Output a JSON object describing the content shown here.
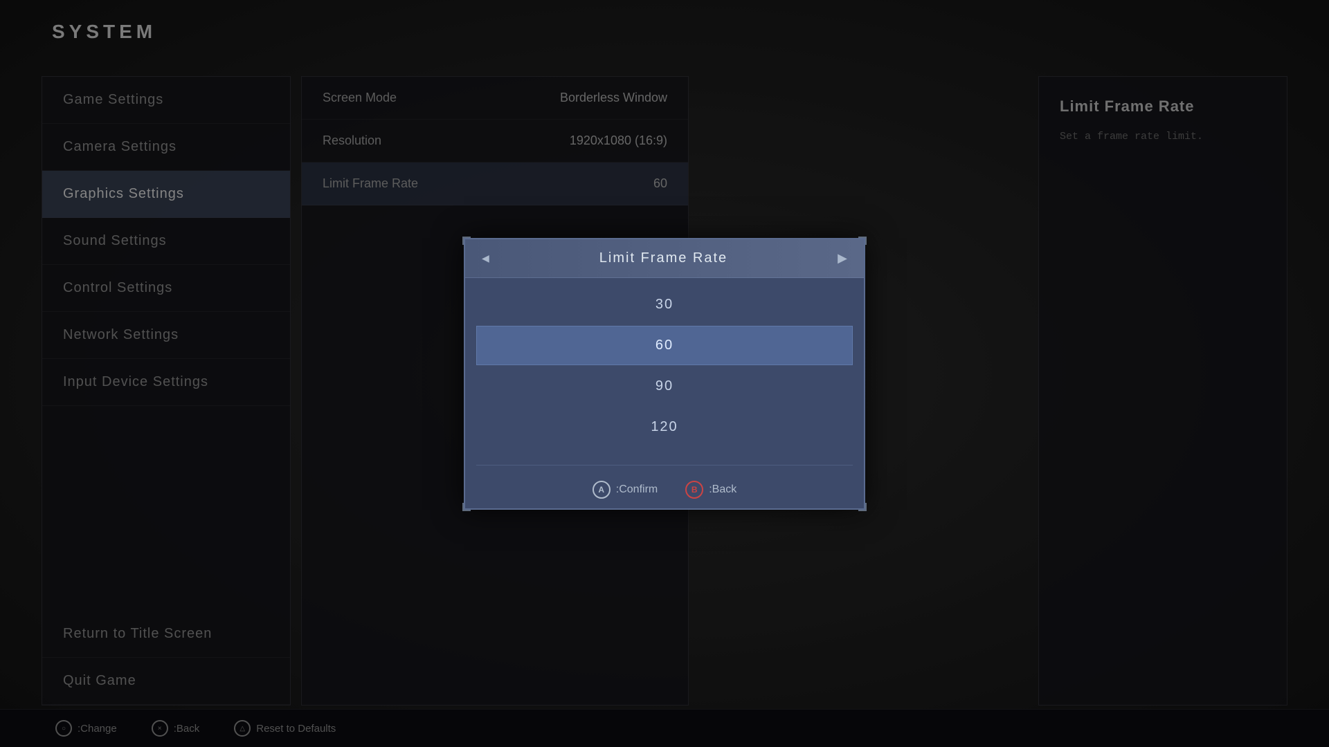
{
  "system": {
    "title": "SYSTEM"
  },
  "sidebar": {
    "items": [
      {
        "id": "game-settings",
        "label": "Game Settings",
        "active": false
      },
      {
        "id": "camera-settings",
        "label": "Camera Settings",
        "active": false
      },
      {
        "id": "graphics-settings",
        "label": "Graphics Settings",
        "active": true
      },
      {
        "id": "sound-settings",
        "label": "Sound Settings",
        "active": false
      },
      {
        "id": "control-settings",
        "label": "Control Settings",
        "active": false
      },
      {
        "id": "network-settings",
        "label": "Network Settings",
        "active": false
      },
      {
        "id": "input-device-settings",
        "label": "Input Device Settings",
        "active": false
      }
    ],
    "bottom_items": [
      {
        "id": "return-to-title",
        "label": "Return to Title Screen"
      },
      {
        "id": "quit-game",
        "label": "Quit Game"
      }
    ]
  },
  "settings_panel": {
    "rows": [
      {
        "label": "Screen Mode",
        "value": "Borderless Window"
      },
      {
        "label": "Resolution",
        "value": "1920x1080 (16:9)"
      },
      {
        "label": "Limit Frame Rate",
        "value": "60",
        "highlighted": true
      }
    ]
  },
  "right_panel": {
    "title": "Limit Frame Rate",
    "description": "Set a frame rate limit."
  },
  "modal": {
    "title": "Limit Frame Rate",
    "options": [
      {
        "value": "30",
        "selected": false
      },
      {
        "value": "60",
        "selected": true
      },
      {
        "value": "90",
        "selected": false
      },
      {
        "value": "120",
        "selected": false
      }
    ],
    "confirm_label": ":Confirm",
    "back_label": ":Back"
  },
  "bottom_bar": {
    "change_label": ":Change",
    "back_label": ":Back",
    "reset_label": "Reset to Defaults"
  }
}
